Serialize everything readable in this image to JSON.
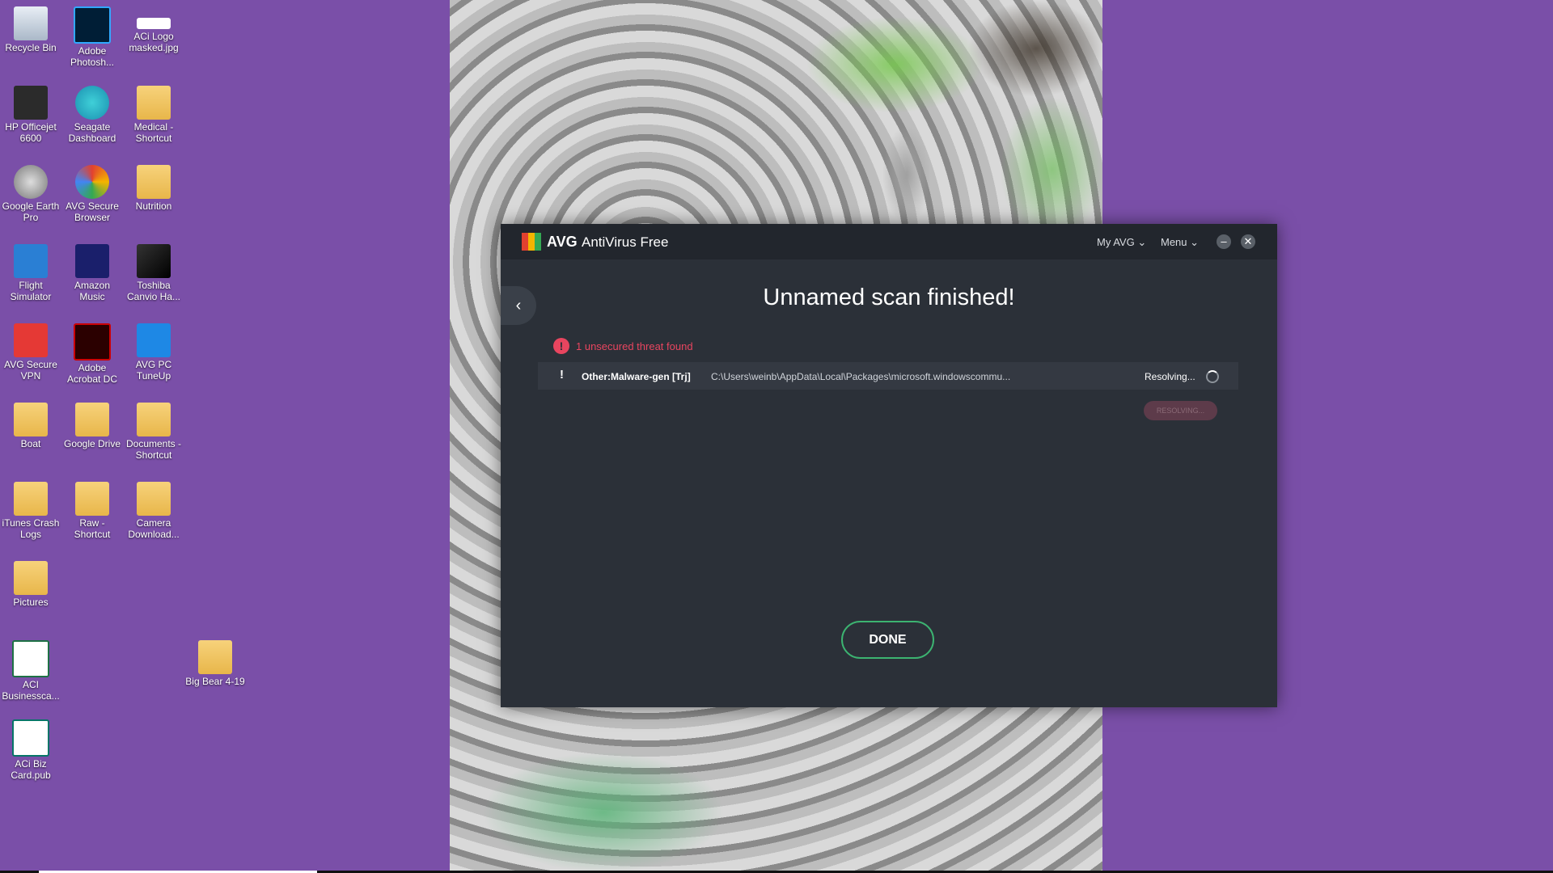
{
  "desktop": {
    "icons": [
      {
        "label": "Recycle Bin",
        "icon": "recycle-bin-icon"
      },
      {
        "label": "Adobe Photosh...",
        "icon": "photoshop-icon"
      },
      {
        "label": "ACi Logo masked.jpg",
        "icon": "image-file-icon"
      },
      {
        "label": "HP Officejet 6600",
        "icon": "printer-icon"
      },
      {
        "label": "Seagate Dashboard",
        "icon": "seagate-icon"
      },
      {
        "label": "Medical - Shortcut",
        "icon": "folder-icon"
      },
      {
        "label": "Google Earth Pro",
        "icon": "google-earth-icon"
      },
      {
        "label": "AVG Secure Browser",
        "icon": "avg-browser-icon"
      },
      {
        "label": "Nutrition",
        "icon": "folder-icon"
      },
      {
        "label": "Flight Simulator",
        "icon": "airplane-icon"
      },
      {
        "label": "Amazon Music",
        "icon": "amazon-music-icon"
      },
      {
        "label": "Toshiba Canvio Ha...",
        "icon": "drive-icon"
      },
      {
        "label": "AVG Secure VPN",
        "icon": "vpn-icon"
      },
      {
        "label": "Adobe Acrobat DC",
        "icon": "acrobat-icon"
      },
      {
        "label": "AVG PC TuneUp",
        "icon": "tuneup-icon"
      },
      {
        "label": "Boat",
        "icon": "folder-icon"
      },
      {
        "label": "Google Drive",
        "icon": "google-drive-icon"
      },
      {
        "label": "Documents - Shortcut",
        "icon": "folder-icon"
      },
      {
        "label": "iTunes Crash Logs",
        "icon": "folder-icon"
      },
      {
        "label": "Raw - Shortcut",
        "icon": "folder-icon"
      },
      {
        "label": "Camera Download...",
        "icon": "folder-icon"
      },
      {
        "label": "Pictures",
        "icon": "folder-icon"
      },
      {
        "label": "ACI Businessca...",
        "icon": "excel-icon"
      },
      {
        "label": "Big Bear 4-19",
        "icon": "folder-icon"
      },
      {
        "label": "ACi Biz Card.pub",
        "icon": "publisher-icon"
      }
    ]
  },
  "avg_window": {
    "brand": "AVG",
    "product": "AntiVirus Free",
    "nav_myavg": "My AVG ⌄",
    "nav_menu": "Menu ⌄",
    "minimize_glyph": "–",
    "close_glyph": "✕",
    "back_glyph": "‹",
    "heading": "Unnamed scan finished!",
    "threat_summary": "1 unsecured threat found",
    "summary_glyph": "!",
    "threat": {
      "marker": "!",
      "name": "Other:Malware-gen [Trj]",
      "path": "C:\\Users\\weinb\\AppData\\Local\\Packages\\microsoft.windowscommu...",
      "status": "Resolving..."
    },
    "resolving_button": "RESOLVING...",
    "done_button": "DONE",
    "colors": {
      "accent_green": "#3cb371",
      "threat_red": "#e8455f"
    }
  }
}
